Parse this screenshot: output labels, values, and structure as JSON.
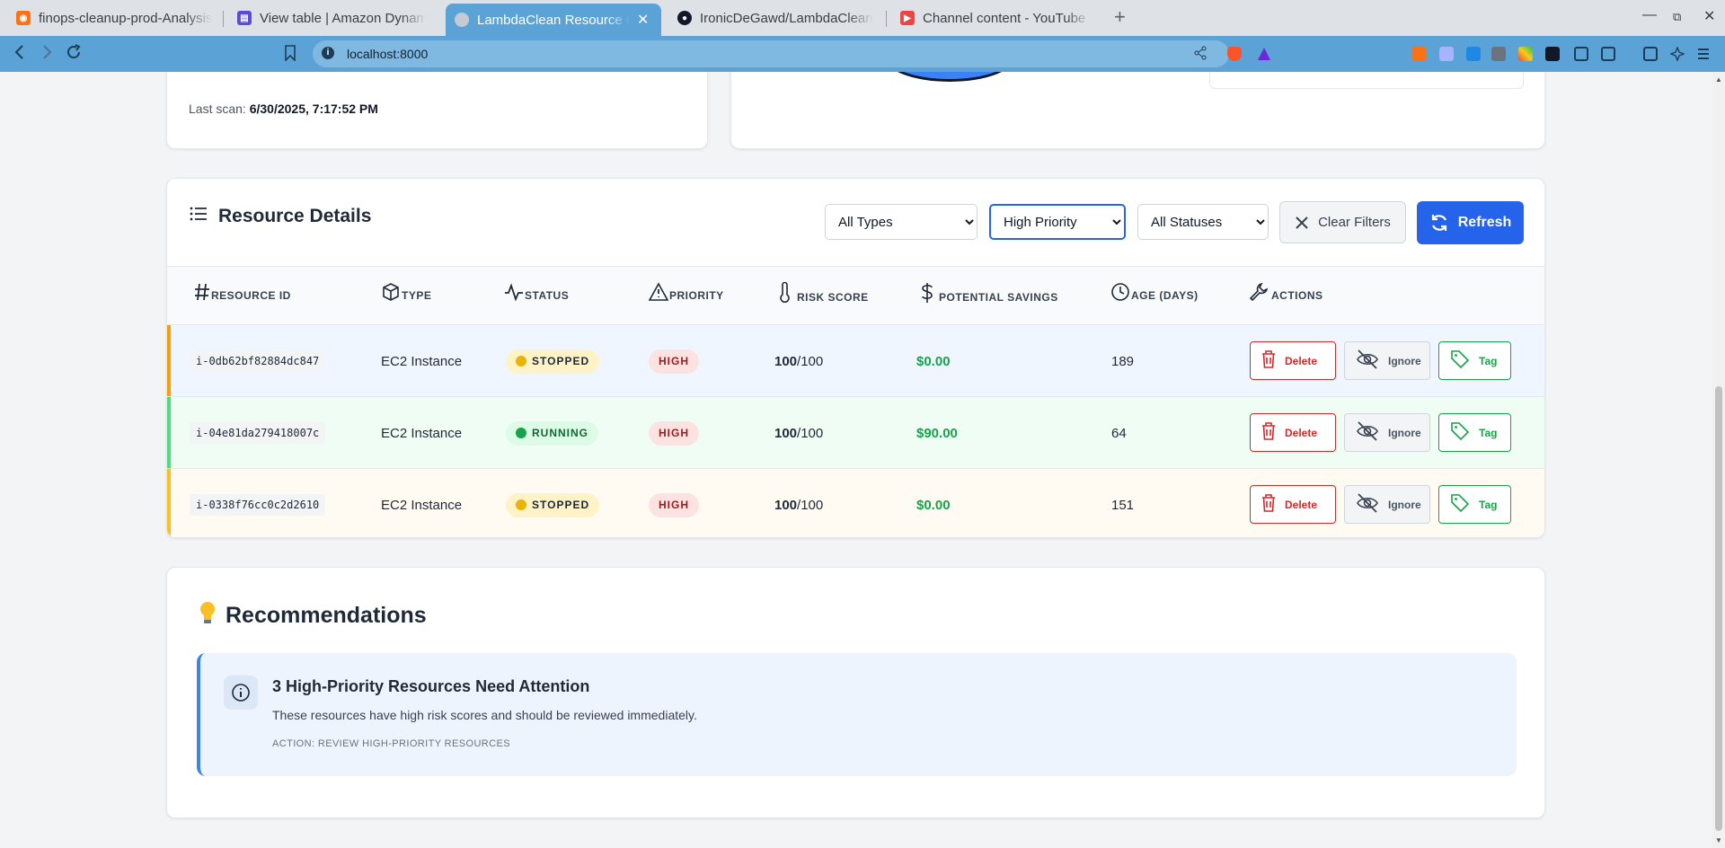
{
  "browser": {
    "tabs": [
      {
        "title": "finops-cleanup-prod-Analysis",
        "favicon": "rss-icon",
        "color": "#f97316"
      },
      {
        "title": "View table | Amazon DynamoDB",
        "favicon": "aws-icon",
        "color": "#5b4bd6"
      },
      {
        "title": "LambdaClean Resource Cleanup",
        "favicon": "globe-icon",
        "color": "#9aa0a6",
        "active": true
      },
      {
        "title": "IronicDeGawd/LambdaClean",
        "favicon": "github-icon",
        "color": "#111827"
      },
      {
        "title": "Channel content - YouTube Studio",
        "favicon": "youtube-icon",
        "color": "#ef4444"
      }
    ],
    "url": "localhost:8000"
  },
  "summary": {
    "last_scan_label": "Last scan:",
    "last_scan_value": "6/30/2025, 7:17:52 PM"
  },
  "resource_details": {
    "title": "Resource Details",
    "filters": {
      "type": {
        "selected": "All Types",
        "options": [
          "All Types"
        ]
      },
      "priority": {
        "selected": "High Priority",
        "options": [
          "High Priority"
        ]
      },
      "status": {
        "selected": "All Statuses",
        "options": [
          "All Statuses"
        ]
      }
    },
    "clear_label": "Clear Filters",
    "refresh_label": "Refresh",
    "columns": [
      "Resource ID",
      "Type",
      "Status",
      "Priority",
      "Risk Score",
      "Potential Savings",
      "Age (Days)",
      "Actions"
    ],
    "rows": [
      {
        "id": "i-0db62bf82884dc847",
        "type": "EC2 Instance",
        "status": "STOPPED",
        "priority": "HIGH",
        "risk": "100",
        "risk_max": "/100",
        "savings": "$0.00",
        "age": "189",
        "accent": "#f59e0b",
        "bg": "#eff6ff",
        "status_bg": "#fef3c7",
        "status_fg": "#1f2937",
        "dot": "#eab308"
      },
      {
        "id": "i-04e81da279418007c",
        "type": "EC2 Instance",
        "status": "RUNNING",
        "priority": "HIGH",
        "risk": "100",
        "risk_max": "/100",
        "savings": "$90.00",
        "age": "64",
        "accent": "#4ade80",
        "bg": "#f0fdf4",
        "status_bg": "#dcfce7",
        "status_fg": "#166534",
        "dot": "#16a34a"
      },
      {
        "id": "i-0338f76cc0c2d2610",
        "type": "EC2 Instance",
        "status": "STOPPED",
        "priority": "HIGH",
        "risk": "100",
        "risk_max": "/100",
        "savings": "$0.00",
        "age": "151",
        "accent": "#fbbf24",
        "bg": "#fffbf3",
        "status_bg": "#fef3c7",
        "status_fg": "#1f2937",
        "dot": "#eab308"
      }
    ],
    "actions": {
      "delete": "Delete",
      "ignore": "Ignore",
      "tag": "Tag"
    }
  },
  "recommendations": {
    "title": "Recommendations",
    "alert_title": "3 High-Priority Resources Need Attention",
    "alert_text": "These resources have high risk scores and should be reviewed immediately.",
    "alert_action": "Action: Review high-priority resources"
  }
}
